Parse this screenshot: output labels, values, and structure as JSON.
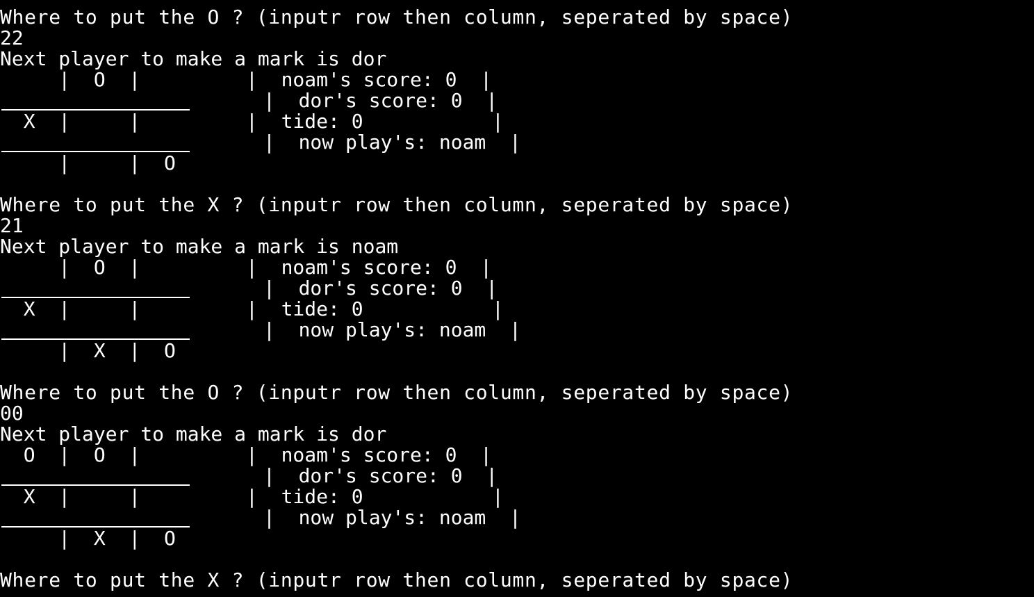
{
  "background_color": "#000000",
  "text_color": "#ffffff",
  "blocks": [
    {
      "prompt": "Where to put the O ? (inputr row then column, seperated by space)",
      "input": "22",
      "next": "Next player to make a mark is dor",
      "row1": "     |  O  |         |  noam's score: 0  |",
      "sep1": "|  dor's score: 0  |",
      "row2": "  X  |     |         |  tide: 0           |",
      "sep2": "|  now play's: noam  |",
      "row3": "     |     |  O"
    },
    {
      "prompt": "Where to put the X ? (inputr row then column, seperated by space)",
      "input": "21",
      "next": "Next player to make a mark is noam",
      "row1": "     |  O  |         |  noam's score: 0  |",
      "sep1": "|  dor's score: 0  |",
      "row2": "  X  |     |         |  tide: 0           |",
      "sep2": "|  now play's: noam  |",
      "row3": "     |  X  |  O"
    },
    {
      "prompt": "Where to put the O ? (inputr row then column, seperated by space)",
      "input": "00",
      "next": "Next player to make a mark is dor",
      "row1": "  O  |  O  |         |  noam's score: 0  |",
      "sep1": "|  dor's score: 0  |",
      "row2": "  X  |     |         |  tide: 0           |",
      "sep2": "|  now play's: noam  |",
      "row3": "     |  X  |  O"
    }
  ],
  "final_prompt": "Where to put the X ? (inputr row then column, seperated by space)"
}
